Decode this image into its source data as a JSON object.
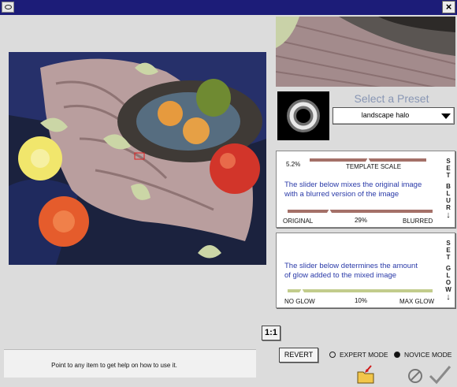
{
  "preset": {
    "title": "Select a Preset",
    "selected": "landscape halo"
  },
  "blur_panel": {
    "template_value": "5.2%",
    "template_label": "TEMPLATE SCALE",
    "template_level": 0.5,
    "description_1": "The slider below mixes the original image",
    "description_2": "with a blurred version of the image",
    "min_label": "ORIGINAL",
    "value": "29%",
    "level": 0.29,
    "max_label": "BLURRED",
    "side_label": [
      "S",
      "E",
      "T",
      "",
      "B",
      "L",
      "U",
      "R"
    ]
  },
  "glow_panel": {
    "description_1": "The slider below determines the amount",
    "description_2": "of glow added to the mixed image",
    "min_label": "NO GLOW",
    "value": "10%",
    "level": 0.1,
    "max_label": "MAX GLOW",
    "side_label": [
      "S",
      "E",
      "T",
      "",
      "G",
      "L",
      "O",
      "W"
    ]
  },
  "zoom_label": "1:1",
  "help_text": "Point to any item to get help on how to use it.",
  "revert_label": "REVERT",
  "modes": {
    "expert_label": "EXPERT MODE",
    "novice_label": "NOVICE MODE",
    "selected": "novice"
  },
  "icons": {
    "app": "eye-icon",
    "close": "close-icon",
    "folder": "folder-icon",
    "cancel": "cancel-icon",
    "ok": "checkmark-icon"
  },
  "colors": {
    "title_bar": "#1c1c78",
    "description_text": "#2a3aa8",
    "blur_track": "#a47068",
    "glow_track": "#c2cc8c",
    "preset_title": "#8896b4"
  }
}
